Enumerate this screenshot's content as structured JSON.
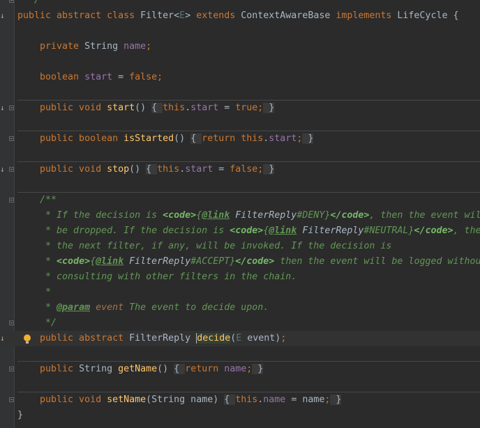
{
  "colors": {
    "background": "#2b2b2b",
    "keyword": "#cc7832",
    "field": "#9876aa",
    "method": "#ffc66d",
    "comment": "#629755",
    "text": "#a9b7c6"
  },
  "gutter": {
    "override_marker_lines": [
      1,
      7,
      11,
      22
    ],
    "fold_marker_lines": [
      0,
      7,
      9,
      11,
      13,
      21,
      24,
      26
    ],
    "separator_before_lines": [
      7,
      9,
      11,
      13,
      24,
      26
    ],
    "intention_bulb_line": 22,
    "current_line": 22,
    "icons": {
      "override": "implements-arrow-icon",
      "fold": "fold-toggle-icon",
      "bulb": "lightbulb-icon"
    }
  },
  "code": {
    "lines": [
      {
        "tokens": [
          {
            "t": "dc",
            "v": "  */"
          }
        ]
      },
      {
        "tokens": [
          {
            "t": "kw",
            "v": "public abstract class "
          },
          {
            "t": "pl",
            "v": "Filter<"
          },
          {
            "t": "tp",
            "v": "E"
          },
          {
            "t": "pl",
            "v": "> "
          },
          {
            "t": "kw",
            "v": "extends "
          },
          {
            "t": "pl",
            "v": "ContextAwareBase "
          },
          {
            "t": "kw",
            "v": "implements "
          },
          {
            "t": "pl",
            "v": "LifeCycle {"
          }
        ]
      },
      {
        "tokens": []
      },
      {
        "tokens": [
          {
            "t": "kw",
            "v": "    private "
          },
          {
            "t": "pl",
            "v": "String "
          },
          {
            "t": "fd",
            "v": "name"
          },
          {
            "t": "kw",
            "v": ";"
          }
        ]
      },
      {
        "tokens": []
      },
      {
        "tokens": [
          {
            "t": "kw",
            "v": "    boolean "
          },
          {
            "t": "fd",
            "v": "start"
          },
          {
            "t": "pl",
            "v": " = "
          },
          {
            "t": "kw",
            "v": "false;"
          }
        ]
      },
      {
        "tokens": []
      },
      {
        "tokens": [
          {
            "t": "kw",
            "v": "    public void "
          },
          {
            "t": "md",
            "v": "start"
          },
          {
            "t": "pl",
            "v": "() "
          },
          {
            "t": "fold",
            "v": "{ "
          },
          {
            "t": "kw",
            "v": "this"
          },
          {
            "t": "pl",
            "v": "."
          },
          {
            "t": "fd",
            "v": "start"
          },
          {
            "t": "pl",
            "v": " = "
          },
          {
            "t": "kw",
            "v": "true;"
          },
          {
            "t": "fold",
            "v": " }"
          }
        ]
      },
      {
        "tokens": []
      },
      {
        "tokens": [
          {
            "t": "kw",
            "v": "    public boolean "
          },
          {
            "t": "md",
            "v": "isStarted"
          },
          {
            "t": "pl",
            "v": "() "
          },
          {
            "t": "fold",
            "v": "{ "
          },
          {
            "t": "kw",
            "v": "return this"
          },
          {
            "t": "pl",
            "v": "."
          },
          {
            "t": "fd",
            "v": "start"
          },
          {
            "t": "kw",
            "v": ";"
          },
          {
            "t": "fold",
            "v": " }"
          }
        ]
      },
      {
        "tokens": []
      },
      {
        "tokens": [
          {
            "t": "kw",
            "v": "    public void "
          },
          {
            "t": "md",
            "v": "stop"
          },
          {
            "t": "pl",
            "v": "() "
          },
          {
            "t": "fold",
            "v": "{ "
          },
          {
            "t": "kw",
            "v": "this"
          },
          {
            "t": "pl",
            "v": "."
          },
          {
            "t": "fd",
            "v": "start"
          },
          {
            "t": "pl",
            "v": " = "
          },
          {
            "t": "kw",
            "v": "false;"
          },
          {
            "t": "fold",
            "v": " }"
          }
        ]
      },
      {
        "tokens": []
      },
      {
        "tokens": [
          {
            "t": "dc",
            "v": "    /**"
          }
        ]
      },
      {
        "tokens": [
          {
            "t": "dc",
            "v": "     * If the decision is "
          },
          {
            "t": "dh",
            "v": "<code>"
          },
          {
            "t": "dc",
            "v": "{"
          },
          {
            "t": "dt",
            "v": "@link"
          },
          {
            "t": "dc",
            "v": " "
          },
          {
            "t": "dl",
            "v": "FilterReply"
          },
          {
            "t": "dc",
            "v": "#DENY}"
          },
          {
            "t": "dh",
            "v": "</code>"
          },
          {
            "t": "dc",
            "v": ", then the event will"
          }
        ]
      },
      {
        "tokens": [
          {
            "t": "dc",
            "v": "     * be dropped. If the decision is "
          },
          {
            "t": "dh",
            "v": "<code>"
          },
          {
            "t": "dc",
            "v": "{"
          },
          {
            "t": "dt",
            "v": "@link"
          },
          {
            "t": "dc",
            "v": " "
          },
          {
            "t": "dl",
            "v": "FilterReply"
          },
          {
            "t": "dc",
            "v": "#NEUTRAL}"
          },
          {
            "t": "dh",
            "v": "</code>"
          },
          {
            "t": "dc",
            "v": ", then"
          }
        ]
      },
      {
        "tokens": [
          {
            "t": "dc",
            "v": "     * the next filter, if any, will be invoked. If the decision is"
          }
        ]
      },
      {
        "tokens": [
          {
            "t": "dc",
            "v": "     * "
          },
          {
            "t": "dh",
            "v": "<code>"
          },
          {
            "t": "dc",
            "v": "{"
          },
          {
            "t": "dt",
            "v": "@link"
          },
          {
            "t": "dc",
            "v": " "
          },
          {
            "t": "dl",
            "v": "FilterReply"
          },
          {
            "t": "dc",
            "v": "#ACCEPT}"
          },
          {
            "t": "dh",
            "v": "</code>"
          },
          {
            "t": "dc",
            "v": " then the event will be logged without"
          }
        ]
      },
      {
        "tokens": [
          {
            "t": "dc",
            "v": "     * consulting with other filters in the chain."
          }
        ]
      },
      {
        "tokens": [
          {
            "t": "dc",
            "v": "     *"
          }
        ]
      },
      {
        "tokens": [
          {
            "t": "dc",
            "v": "     * "
          },
          {
            "t": "dt",
            "v": "@param"
          },
          {
            "t": "dc",
            "v": " "
          },
          {
            "t": "dp",
            "v": "event"
          },
          {
            "t": "dc",
            "v": " The event to decide upon."
          }
        ]
      },
      {
        "tokens": [
          {
            "t": "dc",
            "v": "     */"
          }
        ]
      },
      {
        "tokens": [
          {
            "t": "kw",
            "v": "    public abstract "
          },
          {
            "t": "pl",
            "v": "FilterReply "
          },
          {
            "t": "hl",
            "v": "decide"
          },
          {
            "t": "pl",
            "v": "("
          },
          {
            "t": "tp",
            "v": "E"
          },
          {
            "t": "pl",
            "v": " event)"
          },
          {
            "t": "kw",
            "v": ";"
          }
        ]
      },
      {
        "tokens": []
      },
      {
        "tokens": [
          {
            "t": "kw",
            "v": "    public "
          },
          {
            "t": "pl",
            "v": "String "
          },
          {
            "t": "md",
            "v": "getName"
          },
          {
            "t": "pl",
            "v": "() "
          },
          {
            "t": "fold",
            "v": "{ "
          },
          {
            "t": "kw",
            "v": "return "
          },
          {
            "t": "fd",
            "v": "name"
          },
          {
            "t": "kw",
            "v": ";"
          },
          {
            "t": "fold",
            "v": " }"
          }
        ]
      },
      {
        "tokens": []
      },
      {
        "tokens": [
          {
            "t": "kw",
            "v": "    public void "
          },
          {
            "t": "md",
            "v": "setName"
          },
          {
            "t": "pl",
            "v": "(String name) "
          },
          {
            "t": "fold",
            "v": "{ "
          },
          {
            "t": "kw",
            "v": "this"
          },
          {
            "t": "pl",
            "v": "."
          },
          {
            "t": "fd",
            "v": "name"
          },
          {
            "t": "pl",
            "v": " = name"
          },
          {
            "t": "kw",
            "v": ";"
          },
          {
            "t": "fold",
            "v": " }"
          }
        ]
      },
      {
        "tokens": [
          {
            "t": "pl",
            "v": "}"
          }
        ]
      }
    ]
  }
}
